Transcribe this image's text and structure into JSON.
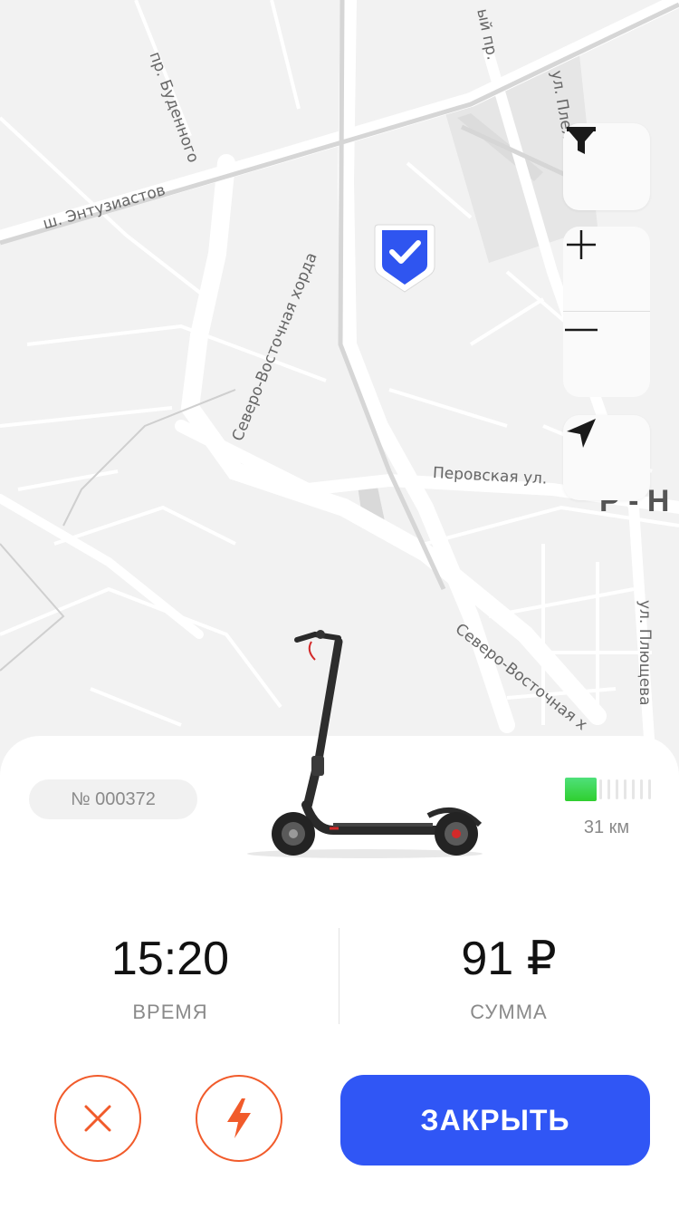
{
  "map": {
    "streets": {
      "budennogo": "пр. Буденного",
      "entuziastov": "ш. Энтузиастов",
      "vh_north": "Северо-Восточная хорда",
      "perovskaya": "Перовская ул.",
      "vh_south": "Северо-Восточная х",
      "plyushcheva": "ул. Плющева",
      "pleh": "ул. Плех",
      "top_pr": "ый пр.",
      "district": "Р - Н"
    },
    "controls": {
      "filter_icon": "filter-icon",
      "zoom_in_icon": "plus-icon",
      "zoom_out_icon": "minus-icon",
      "locate_icon": "navigation-arrow-icon"
    },
    "marker_icon": "parking-check-shield-icon"
  },
  "ride": {
    "scooter_number": "№ 000372",
    "battery_level": 0.36,
    "range": "31 км",
    "time_value": "15:20",
    "time_label": "ВРЕМЯ",
    "sum_value": "91 ₽",
    "sum_label": "СУММА"
  },
  "actions": {
    "cancel_icon": "close-icon",
    "boost_icon": "lightning-icon",
    "close_label": "ЗАКРЫТЬ"
  },
  "colors": {
    "accent": "#3056f5",
    "danger": "#f15b2b",
    "battery": "#35d43a"
  }
}
